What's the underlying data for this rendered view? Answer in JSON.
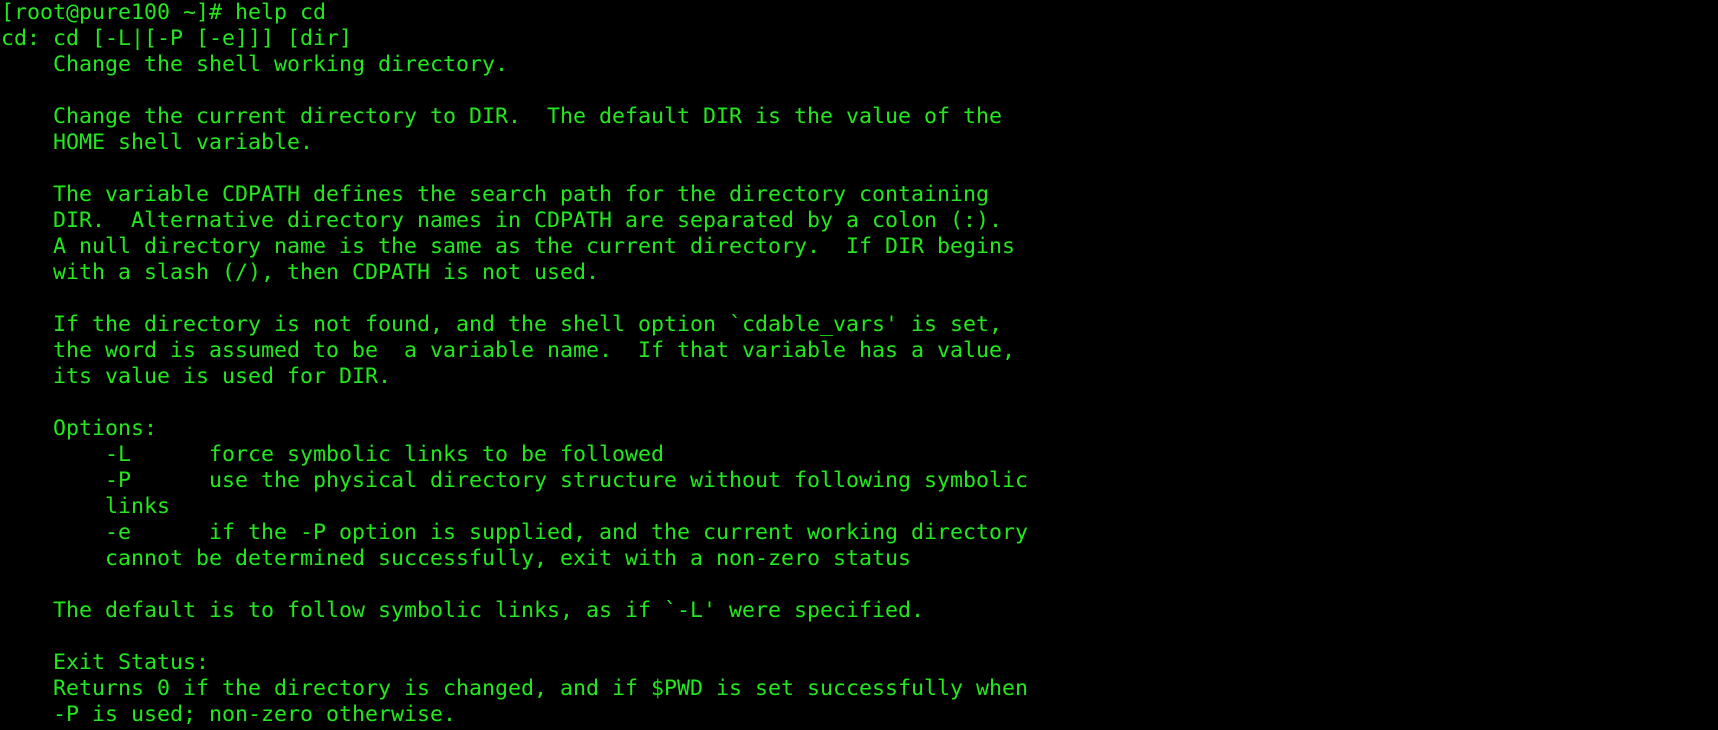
{
  "terminal": {
    "colors": {
      "background": "#000000",
      "foreground": "#22e81d"
    },
    "lines": [
      "[root@pure100 ~]# help cd",
      "cd: cd [-L|[-P [-e]]] [dir]",
      "    Change the shell working directory.",
      "",
      "    Change the current directory to DIR.  The default DIR is the value of the",
      "    HOME shell variable.",
      "",
      "    The variable CDPATH defines the search path for the directory containing",
      "    DIR.  Alternative directory names in CDPATH are separated by a colon (:).",
      "    A null directory name is the same as the current directory.  If DIR begins",
      "    with a slash (/), then CDPATH is not used.",
      "",
      "    If the directory is not found, and the shell option `cdable_vars' is set,",
      "    the word is assumed to be  a variable name.  If that variable has a value,",
      "    its value is used for DIR.",
      "",
      "    Options:",
      "        -L      force symbolic links to be followed",
      "        -P      use the physical directory structure without following symbolic",
      "        links",
      "        -e      if the -P option is supplied, and the current working directory",
      "        cannot be determined successfully, exit with a non-zero status",
      "",
      "    The default is to follow symbolic links, as if `-L' were specified.",
      "",
      "    Exit Status:",
      "    Returns 0 if the directory is changed, and if $PWD is set successfully when",
      "    -P is used; non-zero otherwise."
    ]
  }
}
